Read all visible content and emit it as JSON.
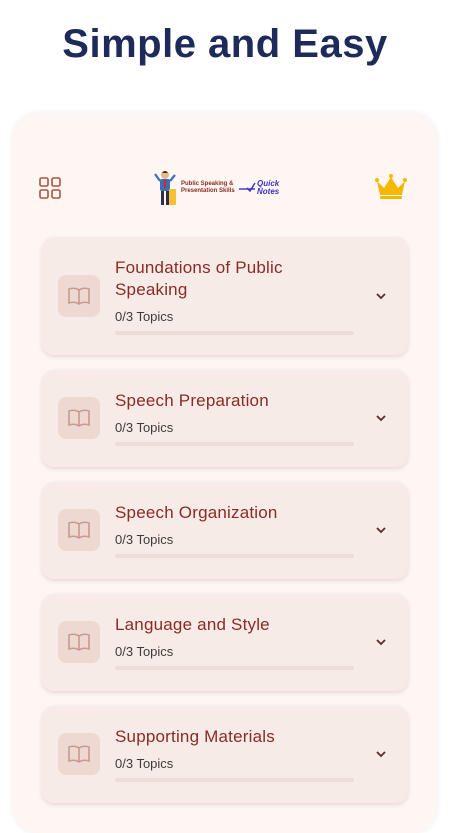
{
  "headline": "Simple and Easy",
  "app": {
    "logo_text": "Public Speaking & Presentation Skills",
    "logo_quick": "Quick",
    "logo_notes": "Notes"
  },
  "icons": {
    "menu": "grid-icon",
    "premium": "crown-icon",
    "chapter": "book-icon",
    "expand": "chevron-down-icon"
  },
  "colors": {
    "headline": "#1d2a5a",
    "title": "#8a2b24",
    "card_bg": "#f7ebe7",
    "crown": "#f5b800"
  },
  "chapters": [
    {
      "title": "Foundations of Public Speaking",
      "topics": "0/3 Topics",
      "progress": 0
    },
    {
      "title": "Speech Preparation",
      "topics": "0/3 Topics",
      "progress": 0
    },
    {
      "title": "Speech Organization",
      "topics": "0/3 Topics",
      "progress": 0
    },
    {
      "title": "Language and Style",
      "topics": "0/3 Topics",
      "progress": 0
    },
    {
      "title": "Supporting Materials",
      "topics": "0/3 Topics",
      "progress": 0
    }
  ]
}
